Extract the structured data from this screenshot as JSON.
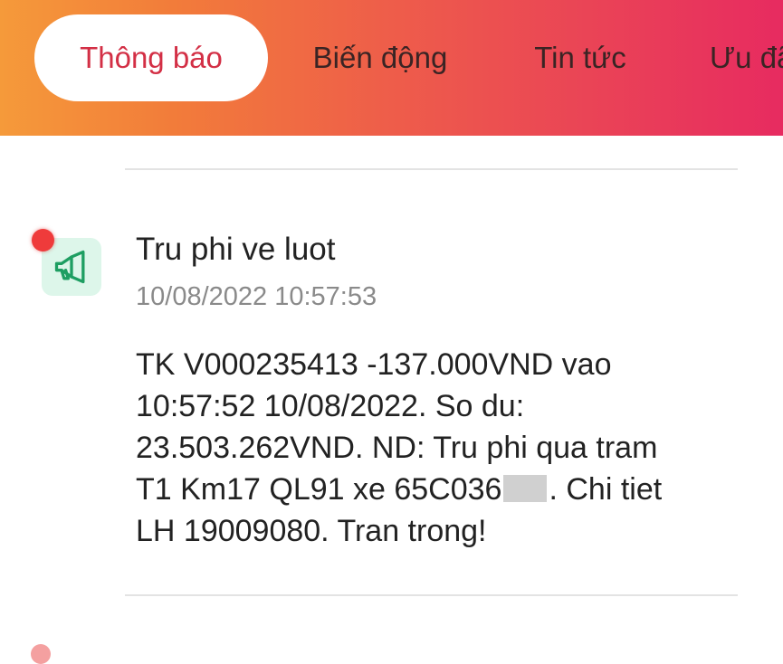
{
  "tabs": [
    {
      "label": "Thông báo",
      "active": true
    },
    {
      "label": "Biến động",
      "active": false
    },
    {
      "label": "Tin tức",
      "active": false
    },
    {
      "label": "Ưu đã",
      "active": false
    }
  ],
  "notification": {
    "icon": "megaphone-icon",
    "unread": true,
    "title": "Tru phi ve luot",
    "time": "10/08/2022 10:57:53",
    "body_lines": [
      "TK V000235413 -137.000VND vao",
      "10:57:52 10/08/2022. So du:",
      "23.503.262VND. ND: Tru phi qua tram",
      "T1 Km17 QL91 xe 65C036",
      ". Chi tiet",
      "LH 19009080. Tran trong!"
    ]
  },
  "colors": {
    "header_gradient_start": "#f59a3a",
    "header_gradient_end": "#e72b60",
    "active_tab_text": "#d32f45",
    "unread_dot": "#ef3b3b",
    "icon_bg": "#ddf6ea",
    "icon_stroke": "#1e9e62"
  }
}
